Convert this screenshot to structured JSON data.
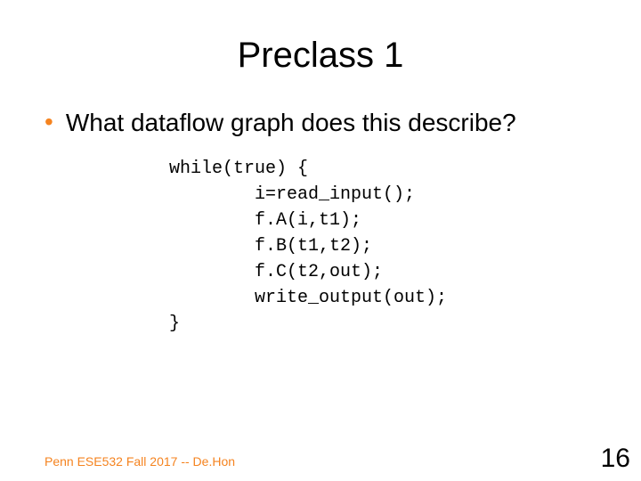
{
  "title": "Preclass 1",
  "bullets": [
    {
      "text": "What dataflow graph does this describe?"
    }
  ],
  "code": {
    "lines": [
      "while(true) {",
      "        i=read_input();",
      "        f.A(i,t1);",
      "        f.B(t1,t2);",
      "        f.C(t2,out);",
      "        write_output(out);",
      "}"
    ]
  },
  "footer": "Penn ESE532 Fall 2017 -- De.Hon",
  "page_number": "16",
  "colors": {
    "accent": "#f5831f"
  }
}
